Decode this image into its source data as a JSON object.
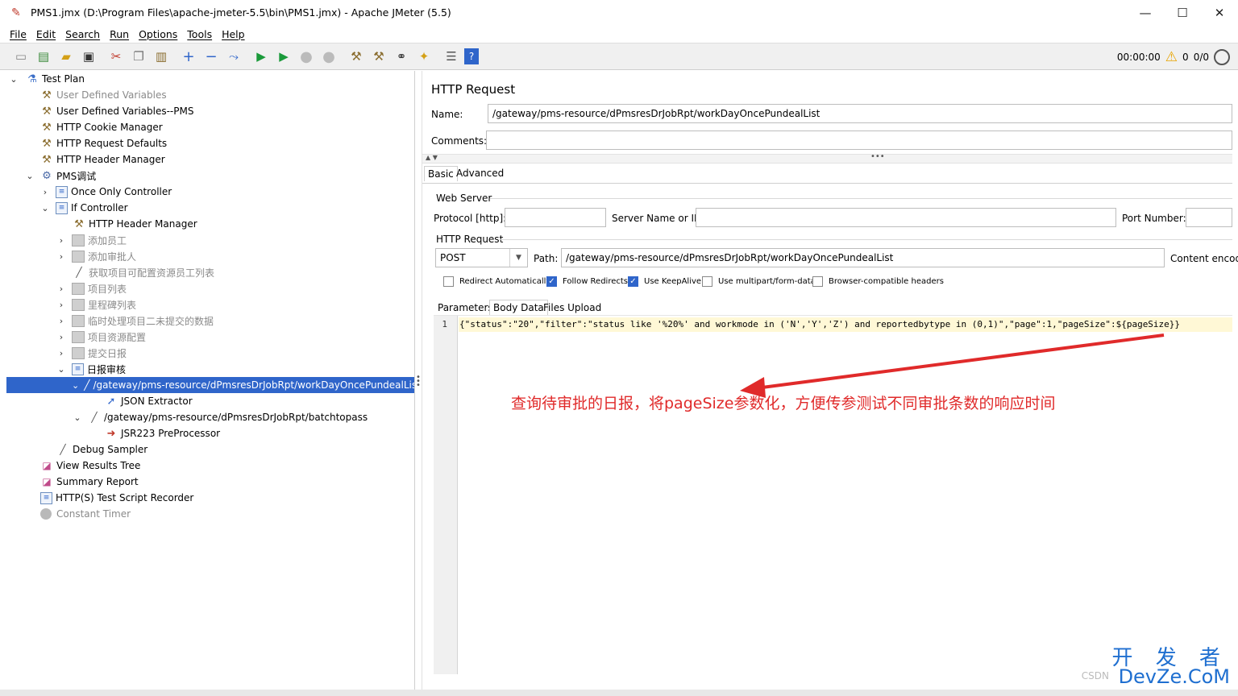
{
  "window": {
    "title": "PMS1.jmx (D:\\Program Files\\apache-jmeter-5.5\\bin\\PMS1.jmx) - Apache JMeter (5.5)",
    "minimize": "—",
    "maximize": "☐",
    "close": "✕"
  },
  "menu": [
    "File",
    "Edit",
    "Search",
    "Run",
    "Options",
    "Tools",
    "Help"
  ],
  "status": {
    "elapsed": "00:00:00",
    "warnings": "0",
    "threads": "0/0"
  },
  "tree": [
    {
      "label": "Test Plan",
      "icon": "flask-icon"
    },
    {
      "label": "User Defined Variables",
      "icon": "config-tool-icon"
    },
    {
      "label": "User Defined Variables--PMS",
      "icon": "config-tool-icon"
    },
    {
      "label": "HTTP Cookie Manager",
      "icon": "config-tool-icon"
    },
    {
      "label": "HTTP Request Defaults",
      "icon": "config-tool-icon"
    },
    {
      "label": "HTTP Header Manager",
      "icon": "config-tool-icon"
    },
    {
      "label": "PMS调试",
      "icon": "thread-group-gear-icon"
    },
    {
      "label": "Once Only Controller",
      "icon": "controller-icon"
    },
    {
      "label": "If Controller",
      "icon": "controller-icon"
    },
    {
      "label": "HTTP Header Manager",
      "icon": "config-tool-icon"
    },
    {
      "label": "添加员工",
      "icon": "disabled-controller-icon"
    },
    {
      "label": "添加审批人",
      "icon": "disabled-controller-icon"
    },
    {
      "label": "获取项目可配置资源员工列表",
      "icon": "sampler-pen-icon"
    },
    {
      "label": "项目列表",
      "icon": "disabled-controller-icon"
    },
    {
      "label": "里程碑列表",
      "icon": "disabled-controller-icon"
    },
    {
      "label": "临时处理项目二未提交的数据",
      "icon": "disabled-controller-icon"
    },
    {
      "label": "项目资源配置",
      "icon": "disabled-controller-icon"
    },
    {
      "label": "提交日报",
      "icon": "disabled-controller-icon"
    },
    {
      "label": "日报审核",
      "icon": "controller-icon"
    },
    {
      "label": "/gateway/pms-resource/dPmsresDrJobRpt/workDayOncePundealList",
      "icon": "sampler-pen-icon"
    },
    {
      "label": "JSON Extractor",
      "icon": "extractor-arrow-icon"
    },
    {
      "label": "/gateway/pms-resource/dPmsresDrJobRpt/batchtopass",
      "icon": "sampler-pen-icon"
    },
    {
      "label": "JSR223 PreProcessor",
      "icon": "preprocessor-icon"
    },
    {
      "label": "Debug Sampler",
      "icon": "sampler-pen-icon"
    },
    {
      "label": "View Results Tree",
      "icon": "listener-chart-icon"
    },
    {
      "label": "Summary Report",
      "icon": "listener-chart-icon"
    },
    {
      "label": "HTTP(S) Test Script Recorder",
      "icon": "controller-icon"
    },
    {
      "label": "Constant Timer",
      "icon": "timer-icon"
    }
  ],
  "panel": {
    "title": "HTTP Request",
    "name_label": "Name:",
    "name_value": "/gateway/pms-resource/dPmsresDrJobRpt/workDayOncePundealList",
    "comments_label": "Comments:",
    "comments_value": "",
    "tabs": [
      "Basic",
      "Advanced"
    ],
    "web_server": {
      "group_title": "Web Server",
      "protocol_label": "Protocol [http]:",
      "protocol_value": "",
      "server_label": "Server Name or IP:",
      "server_value": "",
      "port_label": "Port Number:",
      "port_value": ""
    },
    "http_request": {
      "group_title": "HTTP Request",
      "method": "POST",
      "path_label": "Path:",
      "path_value": "/gateway/pms-resource/dPmsresDrJobRpt/workDayOncePundealList",
      "content_encoding_label": "Content encod"
    },
    "checkboxes": [
      {
        "label": "Redirect Automatically",
        "checked": false
      },
      {
        "label": "Follow Redirects",
        "checked": true
      },
      {
        "label": "Use KeepAlive",
        "checked": true
      },
      {
        "label": "Use multipart/form-data",
        "checked": false
      },
      {
        "label": "Browser-compatible headers",
        "checked": false
      }
    ],
    "body_tabs": [
      "Parameters",
      "Body Data",
      "Files Upload"
    ],
    "body_line_number": "1",
    "body_text": "{\"status\":\"20\",\"filter\":\"status like '%20%' and workmode in ('N','Y','Z') and reportedbytype in (0,1)\",\"page\":1,\"pageSize\":${pageSize}}"
  },
  "annotation": "查询待审批的日报，将pageSize参数化，方便传参测试不同审批条数的响应时间",
  "watermark": {
    "top": "开 发 者",
    "bottom": "DevZe.CoM",
    "csdn": "CSDN"
  },
  "colors": {
    "selection": "#2f65ca",
    "annotation": "#e02a2a",
    "watermark": "#1f6fd0"
  }
}
